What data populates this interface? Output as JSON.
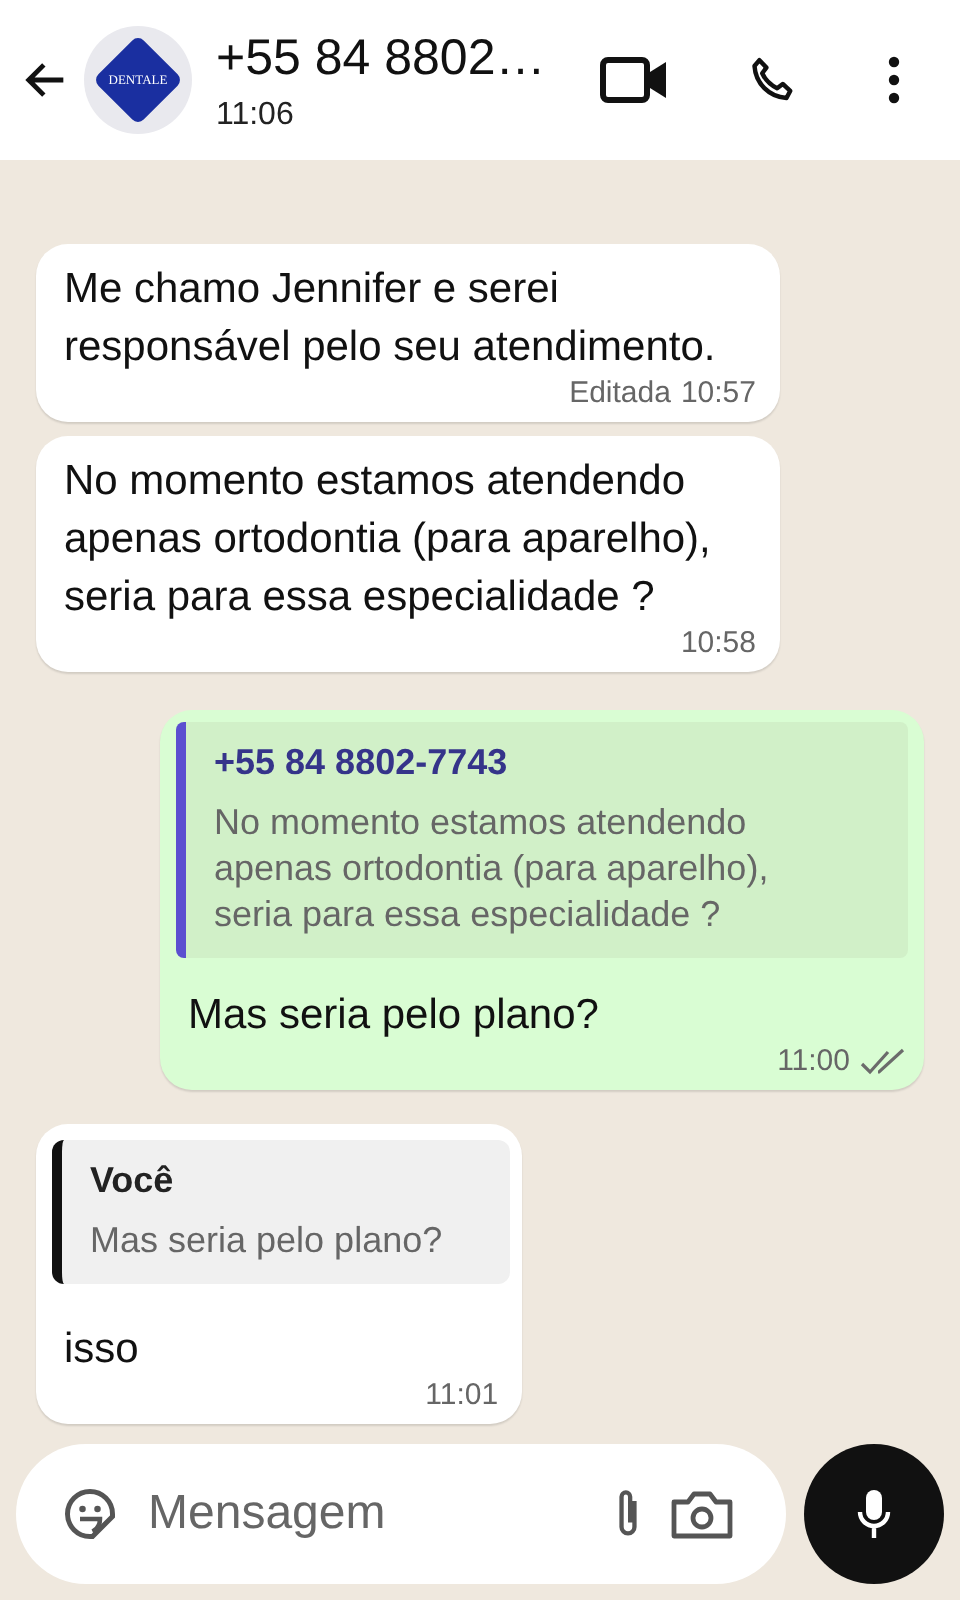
{
  "header": {
    "avatar_label": "DENTALE",
    "title": "+55 84 8802…",
    "subtitle": "11:06"
  },
  "messages": [
    {
      "kind": "incoming",
      "text": "Me chamo Jennifer e serei responsável pelo seu atendimento.",
      "edited": "Editada",
      "time": "10:57"
    },
    {
      "kind": "incoming",
      "text": "No momento estamos atendendo apenas ortodontia (para aparelho), seria para essa especialidade ?",
      "time": "10:58"
    },
    {
      "kind": "outgoing",
      "quote": {
        "author": "+55 84 8802-7743",
        "text": "No momento estamos atendendo apenas ortodontia (para aparelho), seria para essa especialidade ?",
        "color": "#5b4fd0"
      },
      "text": "Mas seria pelo plano?",
      "time": "11:00",
      "read": false
    },
    {
      "kind": "incoming",
      "quote": {
        "author": "Você",
        "text": "Mas seria pelo plano?",
        "color": "#111111"
      },
      "text": "isso",
      "time": "11:01"
    }
  ],
  "composer": {
    "placeholder": "Mensagem"
  }
}
